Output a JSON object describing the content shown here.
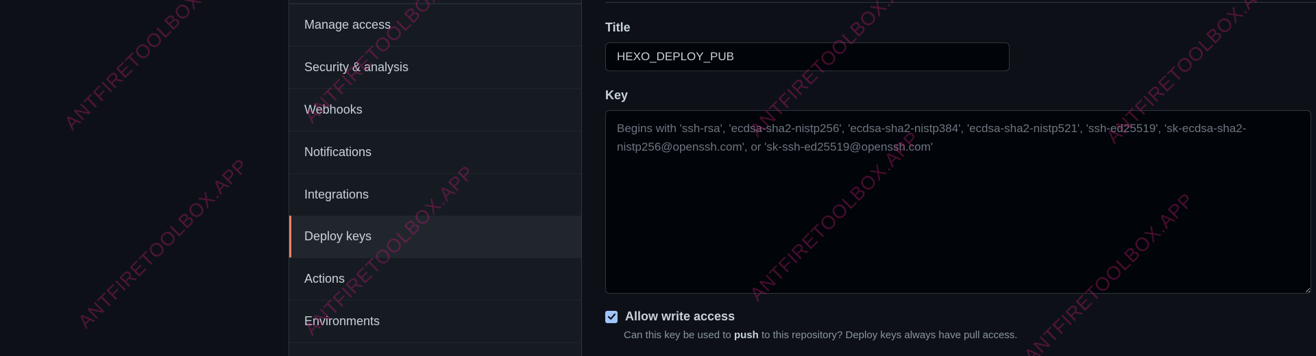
{
  "sidebar": {
    "items": [
      {
        "label": "Manage access",
        "selected": false
      },
      {
        "label": "Security & analysis",
        "selected": false
      },
      {
        "label": "Webhooks",
        "selected": false
      },
      {
        "label": "Notifications",
        "selected": false
      },
      {
        "label": "Integrations",
        "selected": false
      },
      {
        "label": "Deploy keys",
        "selected": true
      },
      {
        "label": "Actions",
        "selected": false
      },
      {
        "label": "Environments",
        "selected": false
      }
    ]
  },
  "form": {
    "title_label": "Title",
    "title_value": "HEXO_DEPLOY_PUB",
    "key_label": "Key",
    "key_placeholder": "Begins with 'ssh-rsa', 'ecdsa-sha2-nistp256', 'ecdsa-sha2-nistp384', 'ecdsa-sha2-nistp521', 'ssh-ed25519', 'sk-ecdsa-sha2-nistp256@openssh.com', or 'sk-ssh-ed25519@openssh.com'",
    "allow_write_label": "Allow write access",
    "allow_write_checked": true,
    "help_prefix": "Can this key be used to ",
    "help_bold": "push",
    "help_suffix": " to this repository? Deploy keys always have pull access."
  },
  "watermark": {
    "text": "ANTFIRETOOLBOX.APP"
  },
  "colors": {
    "page_bg": "#0d1117",
    "sidebar_bg": "#161b22",
    "selected_accent": "#f78166",
    "checkbox_fill": "#9ec5ff",
    "watermark": "#be1e6e"
  }
}
